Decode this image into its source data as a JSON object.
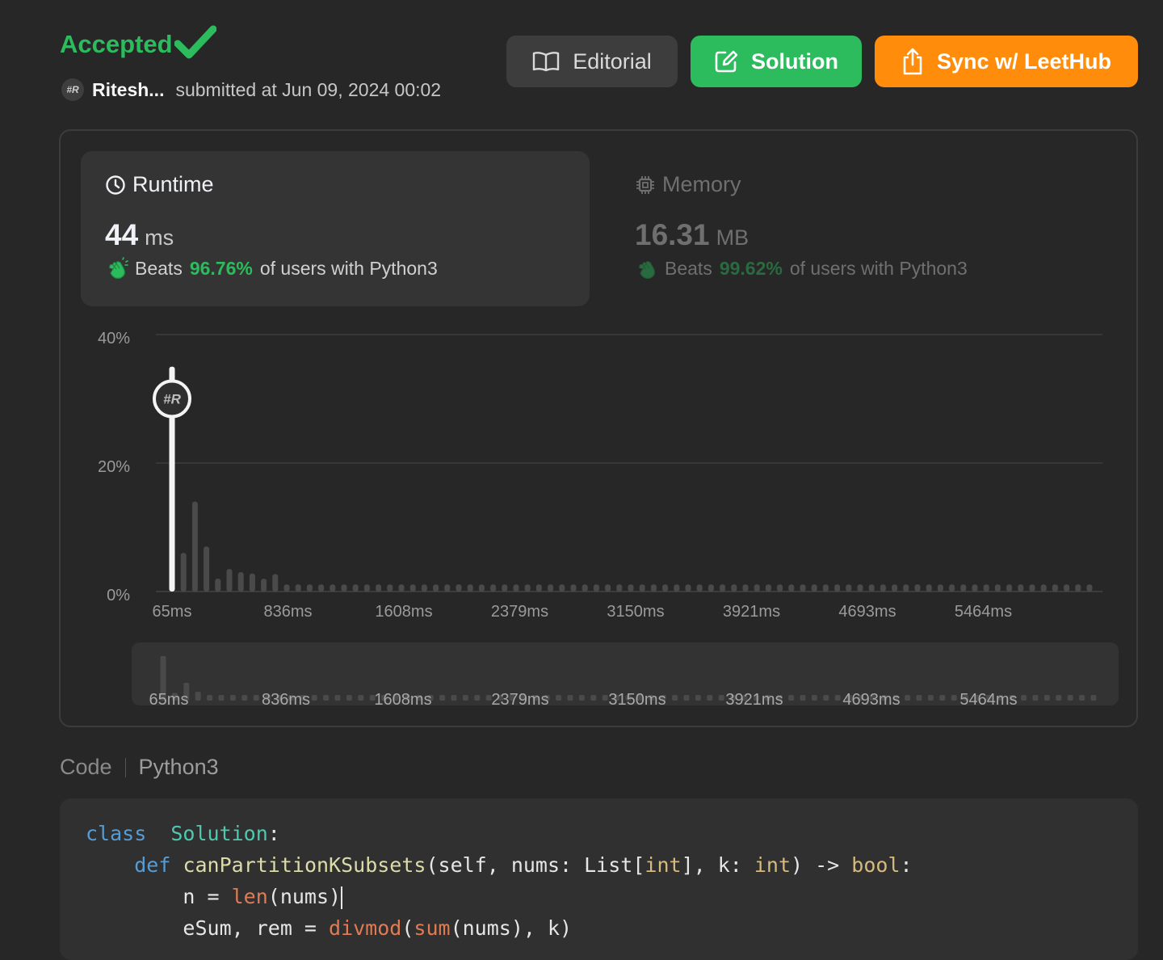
{
  "status": {
    "label": "Accepted",
    "color": "#2cbb5d",
    "icon": "check-icon"
  },
  "submission": {
    "avatar_text": "#R",
    "username": "Ritesh...",
    "submitted_text": "submitted at Jun 09, 2024 00:02"
  },
  "buttons": {
    "editorial": {
      "label": "Editorial",
      "icon": "book-icon"
    },
    "solution": {
      "label": "Solution",
      "icon": "edit-icon",
      "color": "#2cbb5d"
    },
    "sync": {
      "label": "Sync w/ LeetHub",
      "icon": "share-icon",
      "color": "#ff8c0a"
    }
  },
  "runtime": {
    "title": "Runtime",
    "icon": "clock-icon",
    "value": "44",
    "unit": "ms",
    "beats_prefix": "Beats",
    "beats_pct": "96.76%",
    "beats_suffix": "of users with Python3"
  },
  "memory": {
    "title": "Memory",
    "icon": "chip-icon",
    "value": "16.31",
    "unit": "MB",
    "beats_prefix": "Beats",
    "beats_pct": "99.62%",
    "beats_suffix": "of users with Python3"
  },
  "chart_data": {
    "type": "bar",
    "y_ticks": [
      "40%",
      "20%",
      "0%"
    ],
    "ylim": [
      0,
      40
    ],
    "x_tick_labels": [
      "65ms",
      "836ms",
      "1608ms",
      "2379ms",
      "3150ms",
      "3921ms",
      "4693ms",
      "5464ms"
    ],
    "values": [
      35,
      6,
      14,
      7,
      2,
      3.5,
      3,
      2.8,
      2,
      2.7,
      1.1,
      1.1,
      1.1,
      1.1,
      1.1,
      1.1,
      1.1,
      1.1,
      1.1,
      1.1,
      1.1,
      1.1,
      1.1,
      1.1,
      1.1,
      1.1,
      1.1,
      1.1,
      1.1,
      1.1,
      1.1,
      1.1,
      1.1,
      1.1,
      1.1,
      1.1,
      1.1,
      1.1,
      1.1,
      1.1,
      1.1,
      1.1,
      1.1,
      1.1,
      1.1,
      1.1,
      1.1,
      1.1,
      1.1,
      1.1,
      1.1,
      1.1,
      1.1,
      1.1,
      1.1,
      1.1,
      1.1,
      1.1,
      1.1,
      1.1,
      1.1,
      1.1,
      1.1,
      1.1,
      1.1,
      1.1,
      1.1,
      1.1,
      1.1,
      1.1,
      1.1,
      1.1,
      1.1,
      1.1,
      1.1,
      1.1,
      1.1,
      1.1,
      1.1,
      1.1,
      1.1
    ],
    "highlight_index": 0,
    "marker_value": 30,
    "marker_text": "#R",
    "grid": true
  },
  "code": {
    "title": "Code",
    "language": "Python3",
    "lines": [
      [
        [
          "kw",
          "class"
        ],
        [
          "",
          "  "
        ],
        [
          "cls",
          "Solution"
        ],
        [
          "",
          ":"
        ]
      ],
      [
        [
          "",
          "    "
        ],
        [
          "kw",
          "def"
        ],
        [
          "",
          " "
        ],
        [
          "fn",
          "canPartitionKSubsets"
        ],
        [
          "",
          "(self, nums: List["
        ],
        [
          "ty",
          "int"
        ],
        [
          "",
          "], k: "
        ],
        [
          "ty",
          "int"
        ],
        [
          "",
          ") -> "
        ],
        [
          "ty",
          "bool"
        ],
        [
          "",
          ":"
        ]
      ],
      [
        [
          "",
          "        n = "
        ],
        [
          "bi",
          "len"
        ],
        [
          "",
          "(nums)"
        ]
      ],
      [
        [
          "",
          "        eSum, rem = "
        ],
        [
          "bi",
          "divmod"
        ],
        [
          "",
          "("
        ],
        [
          "bi",
          "sum"
        ],
        [
          "",
          "(nums), k)"
        ]
      ]
    ]
  }
}
